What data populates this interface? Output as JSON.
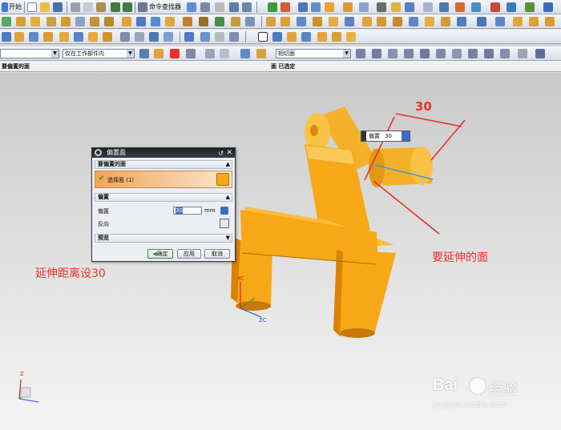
{
  "menu": {
    "start": "开始"
  },
  "toolbar": {
    "command_finder": "命令查找器",
    "filter_value": "仅在工作部件内",
    "face_rule_value": "相切面"
  },
  "cue": {
    "left": "要偏置的面",
    "center": "面 已选定"
  },
  "dialog": {
    "title": "偏置面",
    "section_faces": "要偏置的面",
    "select_face_label": "选择面 (1)",
    "section_offset": "偏置",
    "offset_label": "偏置",
    "offset_value": "30",
    "offset_unit": "mm",
    "reverse_label": "反向",
    "section_preview": "预览",
    "ok": "确定",
    "apply": "应用",
    "cancel": "取消"
  },
  "onscreen_input": {
    "label": "偏置",
    "value": "30"
  },
  "annotations": {
    "dimension": "30",
    "extend_face": "要延伸的面",
    "extend_distance": "延伸距离设30"
  },
  "axes": {
    "xc": "XC",
    "zc": "ZC",
    "z": "Z"
  },
  "watermark": {
    "brand": "Bai",
    "brand2": "经验",
    "url": "jingyan.baidu.com"
  },
  "colors": {
    "part": "#f7a816",
    "part_dark": "#e08a06",
    "annotation": "#e8322a",
    "title_bar": "#1c1f24"
  }
}
